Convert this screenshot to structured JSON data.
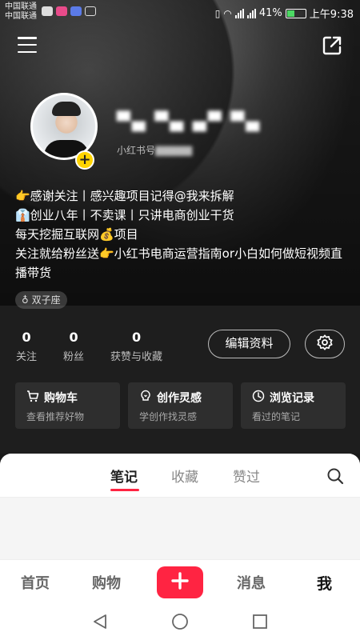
{
  "status_bar": {
    "carrier_1": "中国联通",
    "carrier_2": "中国联通",
    "battery": "41%",
    "time": "上午9:38"
  },
  "profile": {
    "username": "▀▄ ▀▄ ▄▀ ▀▄",
    "redbook_id_label": "小红书号",
    "redbook_id_value": "▇▇▇▇▇",
    "bio_lines": [
      "👉感谢关注丨感兴趣项目记得@我来拆解",
      "👔创业八年丨不卖课丨只讲电商创业干货",
      "每天挖掘互联网💰项目",
      "关注就给粉丝送👉小红书电商运营指南or小白如何做短视频直播带货"
    ],
    "tag": "♁ 双子座"
  },
  "stats": {
    "following_count": "0",
    "following_label": "关注",
    "followers_count": "0",
    "followers_label": "粉丝",
    "likes_count": "0",
    "likes_label": "获赞与收藏"
  },
  "actions": {
    "edit_profile": "编辑资料"
  },
  "cards": [
    {
      "title": "购物车",
      "subtitle": "查看推荐好物",
      "icon": "cart-icon"
    },
    {
      "title": "创作灵感",
      "subtitle": "学创作找灵感",
      "icon": "lightbulb-icon"
    },
    {
      "title": "浏览记录",
      "subtitle": "看过的笔记",
      "icon": "clock-icon"
    }
  ],
  "tabs": [
    {
      "label": "笔记",
      "active": true
    },
    {
      "label": "收藏",
      "active": false
    },
    {
      "label": "赞过",
      "active": false
    }
  ],
  "bottom_nav": {
    "home": "首页",
    "shop": "购物",
    "messages": "消息",
    "me": "我"
  },
  "colors": {
    "accent": "#ff2442",
    "avatar_badge": "#ffd400"
  }
}
